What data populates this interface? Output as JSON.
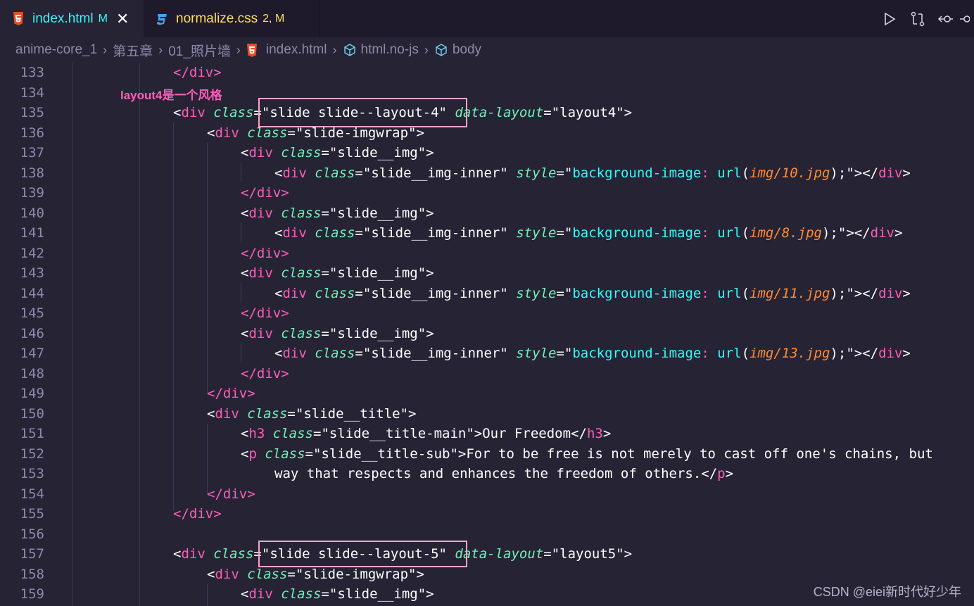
{
  "tabs": [
    {
      "name": "index.html",
      "status": "M",
      "close": "✕"
    },
    {
      "name": "normalize.css",
      "status": "2, M"
    }
  ],
  "breadcrumb": [
    "anime-core_1",
    "第五章",
    "01_照片墙",
    "index.html",
    "html.no-js",
    "body"
  ],
  "annotation": "layout4是一个风格",
  "watermark": "CSDN @eiei新时代好少年",
  "line_numbers": [
    "133",
    "134",
    "135",
    "136",
    "137",
    "138",
    "139",
    "140",
    "141",
    "142",
    "143",
    "144",
    "145",
    "146",
    "147",
    "148",
    "149",
    "150",
    "151",
    "152",
    "153",
    "154",
    "155",
    "156",
    "157",
    "158",
    "159"
  ],
  "code": {
    "l133": "</div>",
    "l135": [
      "<",
      "div",
      " class",
      "=",
      "\"slide slide--layout-4\"",
      " data-layout",
      "=",
      "\"layout4\"",
      ">"
    ],
    "l136": [
      "<",
      "div",
      " class",
      "=",
      "\"slide-imgwrap\"",
      ">"
    ],
    "l137": [
      "<",
      "div",
      " class",
      "=",
      "\"slide__img\"",
      ">"
    ],
    "l138": [
      "<",
      "div",
      " class",
      "=",
      "\"slide__img-inner\"",
      " style",
      "=",
      "\"",
      "background-image",
      ":",
      " url",
      "(",
      "img/10.jpg",
      ");",
      "\"",
      "></",
      "div",
      ">"
    ],
    "l139": "</div>",
    "l140": [
      "<",
      "div",
      " class",
      "=",
      "\"slide__img\"",
      ">"
    ],
    "l141": [
      "<",
      "div",
      " class",
      "=",
      "\"slide__img-inner\"",
      " style",
      "=",
      "\"",
      "background-image",
      ":",
      " url",
      "(",
      "img/8.jpg",
      ");",
      "\"",
      "></",
      "div",
      ">"
    ],
    "l142": "</div>",
    "l143": [
      "<",
      "div",
      " class",
      "=",
      "\"slide__img\"",
      ">"
    ],
    "l144": [
      "<",
      "div",
      " class",
      "=",
      "\"slide__img-inner\"",
      " style",
      "=",
      "\"",
      "background-image",
      ":",
      " url",
      "(",
      "img/11.jpg",
      ");",
      "\"",
      "></",
      "div",
      ">"
    ],
    "l145": "</div>",
    "l146": [
      "<",
      "div",
      " class",
      "=",
      "\"slide__img\"",
      ">"
    ],
    "l147": [
      "<",
      "div",
      " class",
      "=",
      "\"slide__img-inner\"",
      " style",
      "=",
      "\"",
      "background-image",
      ":",
      " url",
      "(",
      "img/13.jpg",
      ");",
      "\"",
      "></",
      "div",
      ">"
    ],
    "l148": "</div>",
    "l149": "</div>",
    "l150": [
      "<",
      "div",
      " class",
      "=",
      "\"slide__title\"",
      ">"
    ],
    "l151": [
      "<",
      "h3",
      " class",
      "=",
      "\"slide__title-main\"",
      ">",
      "Our Freedom",
      "</",
      "h3",
      ">"
    ],
    "l152": [
      "<",
      "p",
      " class",
      "=",
      "\"slide__title-sub\"",
      ">",
      "For to be free is not merely to cast off one's chains, but"
    ],
    "l153": [
      "way that respects and enhances the freedom of others.",
      "</",
      "p",
      ">"
    ],
    "l154": "</div>",
    "l155": "</div>",
    "l157": [
      "<",
      "div",
      " class",
      "=",
      "\"slide slide--layout-5\"",
      " data-layout",
      "=",
      "\"layout5\"",
      ">"
    ],
    "l158": [
      "<",
      "div",
      " class",
      "=",
      "\"slide-imgwrap\"",
      ">"
    ],
    "l159": [
      "<",
      "div",
      " class",
      "=",
      "\"slide__img\"",
      ">"
    ]
  }
}
